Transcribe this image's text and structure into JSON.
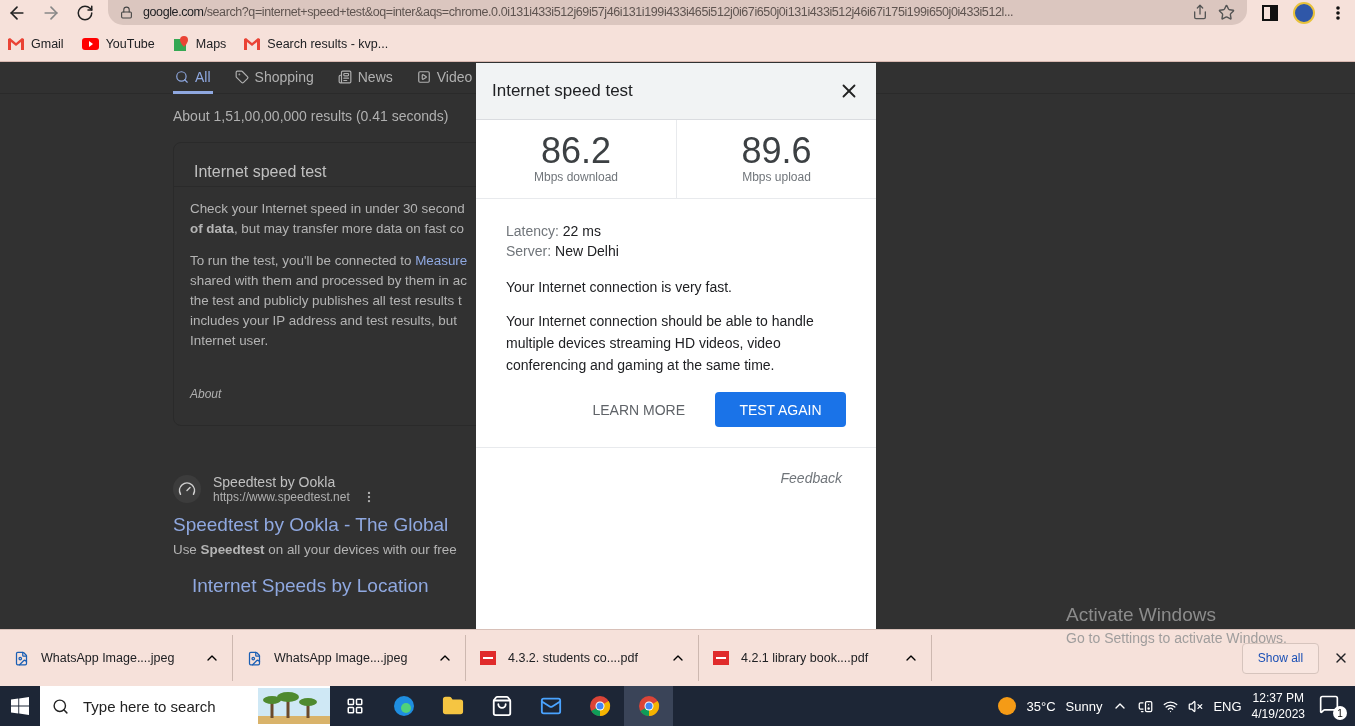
{
  "browser": {
    "url_host": "google.com",
    "url_path": "/search?q=internet+speed+test&oq=inter&aqs=chrome.0.0i131i433i512j69i57j46i131i199i433i465i512j0i67i650j0i131i433i512j46i67i175i199i650j0i433i512l...",
    "bookmarks": [
      {
        "label": "Gmail",
        "kind": "mail"
      },
      {
        "label": "YouTube",
        "kind": "video"
      },
      {
        "label": "Maps",
        "kind": "map"
      },
      {
        "label": "Search results - kvp...",
        "kind": "mail"
      }
    ]
  },
  "search_page": {
    "tabs": [
      {
        "label": "All",
        "kind": "search",
        "selected": true
      },
      {
        "label": "Shopping",
        "kind": "tag",
        "selected": false
      },
      {
        "label": "News",
        "kind": "news",
        "selected": false
      },
      {
        "label": "Video",
        "kind": "video",
        "selected": false
      }
    ],
    "results_count": "About 1,51,00,00,000 results (0.41 seconds)",
    "card": {
      "title": "Internet speed test",
      "paragraphs": [
        [
          {
            "text": "Check your Internet speed in under 30 second"
          },
          {
            "text": "**of data**, but may transfer more data on fast co"
          }
        ],
        [
          {
            "text": "To run the test, you'll be connected to ",
            "link": "Measure"
          },
          {
            "text": "shared with them and processed by them in ac"
          },
          {
            "text": "the test and publicly publishes all test results t"
          },
          {
            "text": "includes your IP address and test results, but"
          },
          {
            "text": "Internet user."
          }
        ]
      ],
      "about": "About"
    },
    "result": {
      "site": "Speedtest by Ookla",
      "url": "https://www.speedtest.net",
      "title": "Speedtest by Ookla - The Global",
      "snippet": "Use **Speedtest** on all your devices with our free",
      "sublink": "Internet Speeds by Location"
    }
  },
  "dialog": {
    "title": "Internet speed test",
    "stats": [
      {
        "value": "86.2",
        "label": "Mbps download"
      },
      {
        "value": "89.6",
        "label": "Mbps upload"
      }
    ],
    "details": [
      {
        "label": "Latency:",
        "value": "22 ms"
      },
      {
        "label": "Server:",
        "value": "New Delhi"
      }
    ],
    "summary": "Your Internet connection is very fast.",
    "description": "Your Internet connection should be able to handle multiple devices streaming HD videos, video conferencing and gaming at the same time.",
    "learn_more": "LEARN MORE",
    "test_again": "TEST AGAIN",
    "feedback": "Feedback"
  },
  "downloads": {
    "items": [
      {
        "name": "WhatsApp Image....jpeg",
        "kind": "image"
      },
      {
        "name": "WhatsApp Image....jpeg",
        "kind": "image"
      },
      {
        "name": "4.3.2. students co....pdf",
        "kind": "pdf"
      },
      {
        "name": "4.2.1 library book....pdf",
        "kind": "pdf"
      }
    ],
    "show_all": "Show all"
  },
  "activation_notice": {
    "title": "Activate Windows",
    "subtitle": "Go to Settings to activate Windows."
  },
  "taskbar": {
    "search_placeholder": "Type here to search",
    "temperature": "35°C",
    "weather": "Sunny",
    "language": "ENG",
    "time": "12:37 PM",
    "date": "4/19/2023",
    "notifications": "1"
  }
}
